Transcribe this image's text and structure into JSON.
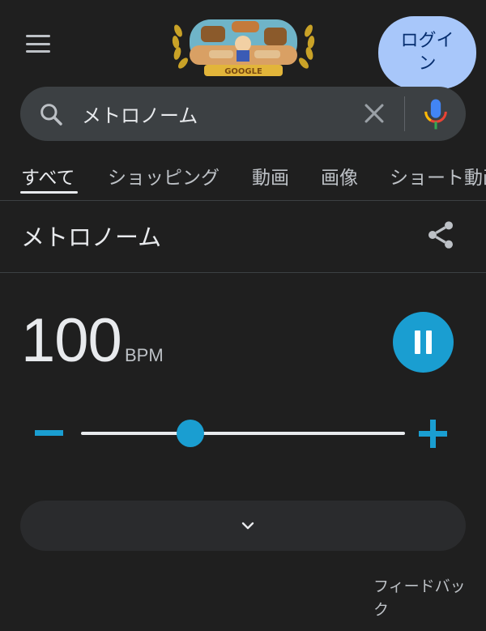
{
  "header": {
    "login_label": "ログイン",
    "doodle_text": "GOOGLE"
  },
  "search": {
    "query": "メトロノーム",
    "placeholder": ""
  },
  "tabs": [
    {
      "label": "すべて",
      "active": true
    },
    {
      "label": "ショッピング",
      "active": false
    },
    {
      "label": "動画",
      "active": false
    },
    {
      "label": "画像",
      "active": false
    },
    {
      "label": "ショート動画",
      "active": false
    }
  ],
  "result": {
    "title": "メトロノーム"
  },
  "metronome": {
    "bpm": "100",
    "unit": "BPM",
    "tempo_value": 100,
    "tempo_min": 40,
    "tempo_max": 218,
    "playing": true
  },
  "feedback": {
    "label": "フィードバック"
  },
  "colors": {
    "background": "#1f1f1f",
    "accent": "#1a9ed1",
    "login_bg": "#a8c7fa",
    "search_bg": "#3c4043"
  },
  "icons": {
    "menu": "hamburger-menu-icon",
    "search": "search-icon",
    "clear": "close-icon",
    "mic": "microphone-icon",
    "share": "share-icon",
    "pause": "pause-icon",
    "minus": "minus-icon",
    "plus": "plus-icon",
    "expand": "chevron-down-icon"
  }
}
